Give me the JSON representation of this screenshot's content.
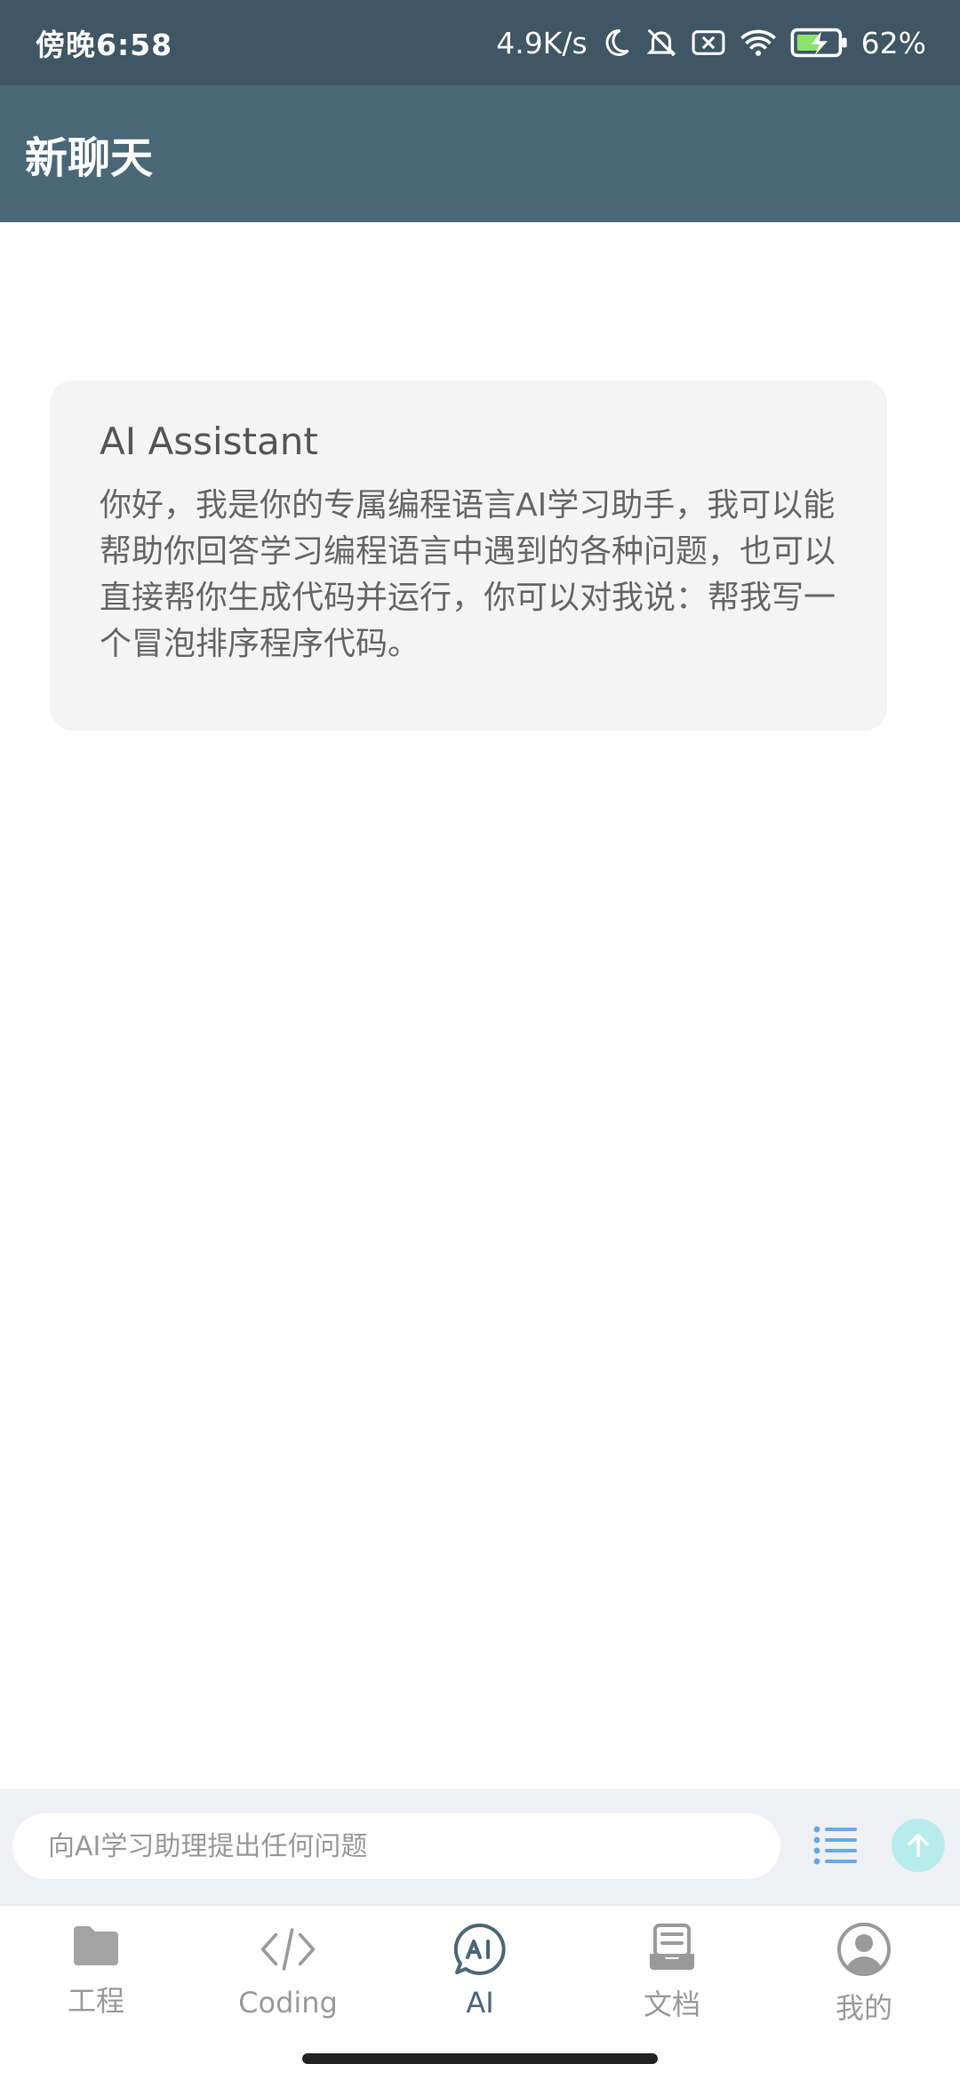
{
  "status_bar": {
    "time": "傍晚6:58",
    "network_speed": "4.9K/s",
    "battery": "62%"
  },
  "app_bar": {
    "title": "新聊天"
  },
  "message": {
    "sender": "AI Assistant",
    "body": "你好，我是你的专属编程语言AI学习助手，我可以能帮助你回答学习编程语言中遇到的各种问题，也可以直接帮你生成代码并运行，你可以对我说：帮我写一个冒泡排序程序代码。"
  },
  "input": {
    "placeholder": "向AI学习助理提出任何问题"
  },
  "nav": {
    "items": [
      {
        "label": "工程",
        "icon": "folder-icon"
      },
      {
        "label": "Coding",
        "icon": "code-icon"
      },
      {
        "label": "AI",
        "icon": "ai-chat-icon"
      },
      {
        "label": "文档",
        "icon": "document-icon"
      },
      {
        "label": "我的",
        "icon": "user-icon"
      }
    ],
    "active": "AI"
  },
  "colors": {
    "status_bar_bg": "#3f5664",
    "app_bar_bg": "#4a6778",
    "send_button_bg": "#b6ecec",
    "accent_blue": "#6aa8e6"
  }
}
